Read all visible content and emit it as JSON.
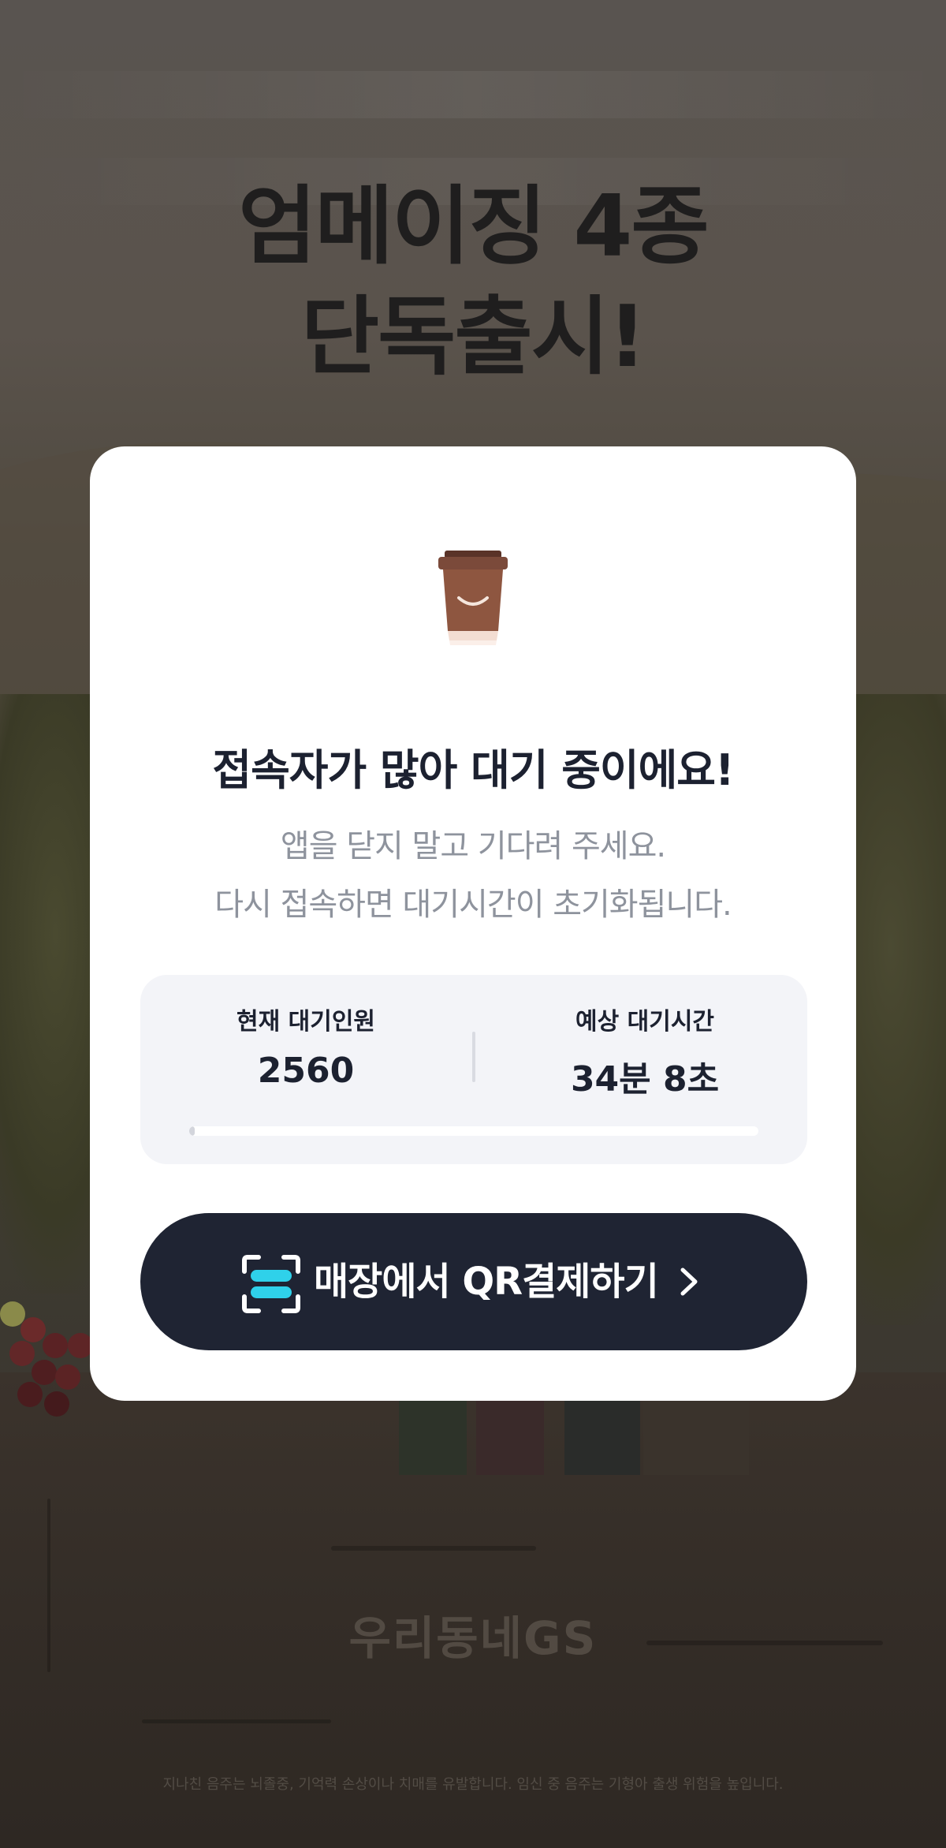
{
  "headline": {
    "line1": "엄메이징 4종",
    "line2": "단독출시!"
  },
  "card": {
    "icon": "coffee-cup-icon",
    "title": "접속자가 많아 대기 중이에요!",
    "subtitle_line1": "앱을 닫지 말고 기다려 주세요.",
    "subtitle_line2": "다시 접속하면 대기시간이 초기화됩니다."
  },
  "queue": {
    "current_label": "현재 대기인원",
    "current_value": "2560",
    "estimate_label": "예상 대기시간",
    "estimate_value": "34분 8초",
    "progress_fraction": 0.01
  },
  "qr_button": {
    "icon": "qr-scan-icon",
    "label": "매장에서 QR결제하기",
    "chevron": "chevron-right-icon"
  },
  "watermark": "우리동네GS",
  "disclaimer": "지나친 음주는 뇌졸중, 기억력 손상이나 치매를 유발합니다. 임신 중 음주는 기형아 출생 위험을 높입니다.",
  "colors": {
    "button_bg": "#1f2433",
    "qr_icon_accent": "#2fd1ea",
    "title_text": "#1c2130",
    "subtitle_text": "#8e939d",
    "stats_bg": "#f3f4f8"
  }
}
